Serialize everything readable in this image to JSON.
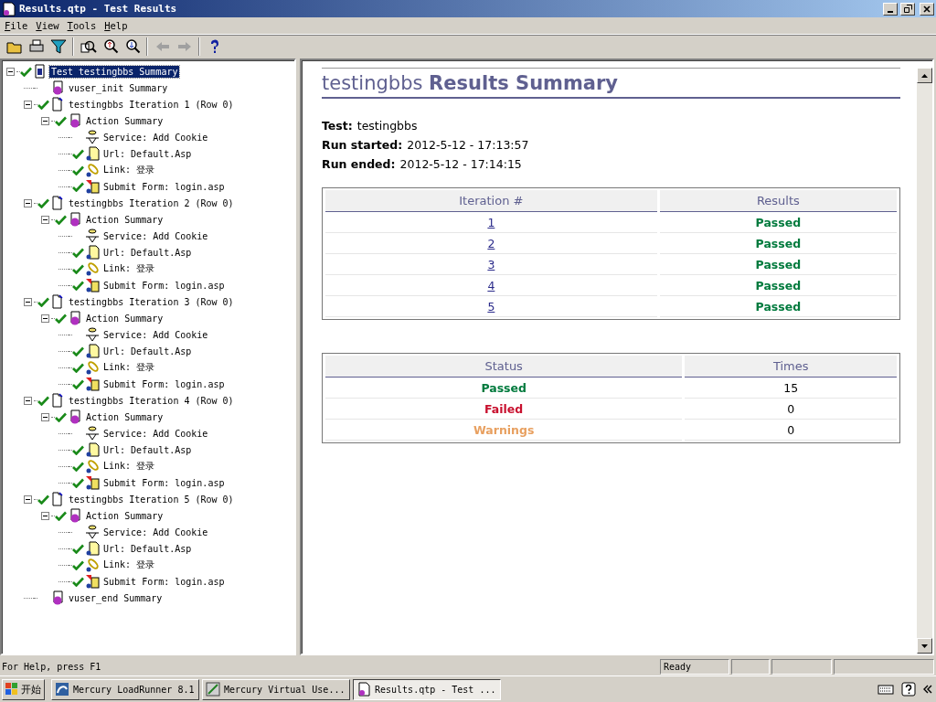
{
  "window": {
    "title": "Results.qtp - Test Results"
  },
  "menu": [
    "File",
    "View",
    "Tools",
    "Help"
  ],
  "toolbar": [
    {
      "kind": "open"
    },
    {
      "kind": "print"
    },
    {
      "kind": "filter"
    },
    {
      "kind": "sep"
    },
    {
      "kind": "find"
    },
    {
      "kind": "zoomup"
    },
    {
      "kind": "zoomdown"
    },
    {
      "kind": "sep"
    },
    {
      "kind": "back",
      "disabled": true
    },
    {
      "kind": "forward",
      "disabled": true
    },
    {
      "kind": "sep"
    },
    {
      "kind": "help"
    }
  ],
  "tree": [
    {
      "label": "Test testingbbs Summary",
      "kind": "test",
      "checked": true,
      "expanded": true,
      "selected": true,
      "children": [
        {
          "label": "vuser_init Summary",
          "kind": "summary",
          "checked": false,
          "selected": false
        },
        {
          "label": "testingbbs Iteration 1 (Row 0)",
          "kind": "iteration",
          "checked": true,
          "expanded": true,
          "selected": false,
          "children": [
            {
              "label": "Action Summary",
              "kind": "summary",
              "checked": true,
              "expanded": true,
              "selected": false,
              "children": [
                {
                  "label": "Service: Add Cookie",
                  "kind": "service",
                  "checked": false,
                  "selected": false
                },
                {
                  "label": "Url: Default.Asp",
                  "kind": "url",
                  "checked": true,
                  "selected": false
                },
                {
                  "label": "Link: 登录",
                  "kind": "link",
                  "checked": true,
                  "selected": false
                },
                {
                  "label": "Submit Form: login.asp",
                  "kind": "form",
                  "checked": true,
                  "selected": false
                }
              ]
            }
          ]
        },
        {
          "label": "testingbbs Iteration 2 (Row 0)",
          "kind": "iteration",
          "checked": true,
          "expanded": true,
          "selected": false,
          "children": [
            {
              "label": "Action Summary",
              "kind": "summary",
              "checked": true,
              "expanded": true,
              "selected": false,
              "children": [
                {
                  "label": "Service: Add Cookie",
                  "kind": "service",
                  "checked": false,
                  "selected": false
                },
                {
                  "label": "Url: Default.Asp",
                  "kind": "url",
                  "checked": true,
                  "selected": false
                },
                {
                  "label": "Link: 登录",
                  "kind": "link",
                  "checked": true,
                  "selected": false
                },
                {
                  "label": "Submit Form: login.asp",
                  "kind": "form",
                  "checked": true,
                  "selected": false
                }
              ]
            }
          ]
        },
        {
          "label": "testingbbs Iteration 3 (Row 0)",
          "kind": "iteration",
          "checked": true,
          "expanded": true,
          "selected": false,
          "children": [
            {
              "label": "Action Summary",
              "kind": "summary",
              "checked": true,
              "expanded": true,
              "selected": false,
              "children": [
                {
                  "label": "Service: Add Cookie",
                  "kind": "service",
                  "checked": false,
                  "selected": false
                },
                {
                  "label": "Url: Default.Asp",
                  "kind": "url",
                  "checked": true,
                  "selected": false
                },
                {
                  "label": "Link: 登录",
                  "kind": "link",
                  "checked": true,
                  "selected": false
                },
                {
                  "label": "Submit Form: login.asp",
                  "kind": "form",
                  "checked": true,
                  "selected": false
                }
              ]
            }
          ]
        },
        {
          "label": "testingbbs Iteration 4 (Row 0)",
          "kind": "iteration",
          "checked": true,
          "expanded": true,
          "selected": false,
          "children": [
            {
              "label": "Action Summary",
              "kind": "summary",
              "checked": true,
              "expanded": true,
              "selected": false,
              "children": [
                {
                  "label": "Service: Add Cookie",
                  "kind": "service",
                  "checked": false,
                  "selected": false
                },
                {
                  "label": "Url: Default.Asp",
                  "kind": "url",
                  "checked": true,
                  "selected": false
                },
                {
                  "label": "Link: 登录",
                  "kind": "link",
                  "checked": true,
                  "selected": false
                },
                {
                  "label": "Submit Form: login.asp",
                  "kind": "form",
                  "checked": true,
                  "selected": false
                }
              ]
            }
          ]
        },
        {
          "label": "testingbbs Iteration 5 (Row 0)",
          "kind": "iteration",
          "checked": true,
          "expanded": true,
          "selected": false,
          "children": [
            {
              "label": "Action Summary",
              "kind": "summary",
              "checked": true,
              "expanded": true,
              "selected": false,
              "children": [
                {
                  "label": "Service: Add Cookie",
                  "kind": "service",
                  "checked": false,
                  "selected": false
                },
                {
                  "label": "Url: Default.Asp",
                  "kind": "url",
                  "checked": true,
                  "selected": false
                },
                {
                  "label": "Link: 登录",
                  "kind": "link",
                  "checked": true,
                  "selected": false
                },
                {
                  "label": "Submit Form: login.asp",
                  "kind": "form",
                  "checked": true,
                  "selected": false
                }
              ]
            }
          ]
        },
        {
          "label": "vuser_end Summary",
          "kind": "summary",
          "checked": false,
          "selected": false
        }
      ]
    }
  ],
  "report": {
    "title": "testingbbs **Results Summary**",
    "info": [
      {
        "label": "Test:",
        "value": "testingbbs"
      },
      {
        "label": "Run started:",
        "value": "2012-5-12 - 17:13:57"
      },
      {
        "label": "Run ended:",
        "value": "2012-5-12 - 17:14:15"
      }
    ],
    "iterations": {
      "columns": [
        "Iteration #",
        "Results"
      ],
      "rows": [
        {
          "iteration": "1",
          "result": "Passed",
          "color": "#007a3d"
        },
        {
          "iteration": "2",
          "result": "Passed",
          "color": "#007a3d"
        },
        {
          "iteration": "3",
          "result": "Passed",
          "color": "#007a3d"
        },
        {
          "iteration": "4",
          "result": "Passed",
          "color": "#007a3d"
        },
        {
          "iteration": "5",
          "result": "Passed",
          "color": "#007a3d"
        }
      ]
    },
    "statuses": {
      "columns": [
        "Status",
        "Times"
      ],
      "rows": [
        {
          "status": "Passed",
          "times": "15",
          "color": "#007a3d"
        },
        {
          "status": "Failed",
          "times": "0",
          "color": "#c8102e"
        },
        {
          "status": "Warnings",
          "times": "0",
          "color": "#e8a060"
        }
      ]
    }
  },
  "status_bar": {
    "help": "For Help, press F1",
    "state": "Ready"
  },
  "taskbar": {
    "start": "开始",
    "tasks": [
      {
        "label": "Mercury LoadRunner 8.1",
        "kind": "loadrunner",
        "selected": false
      },
      {
        "label": "Mercury Virtual Use...",
        "kind": "vugen",
        "selected": false
      },
      {
        "label": "Results.qtp - Test ...",
        "kind": "results",
        "selected": true
      }
    ]
  }
}
